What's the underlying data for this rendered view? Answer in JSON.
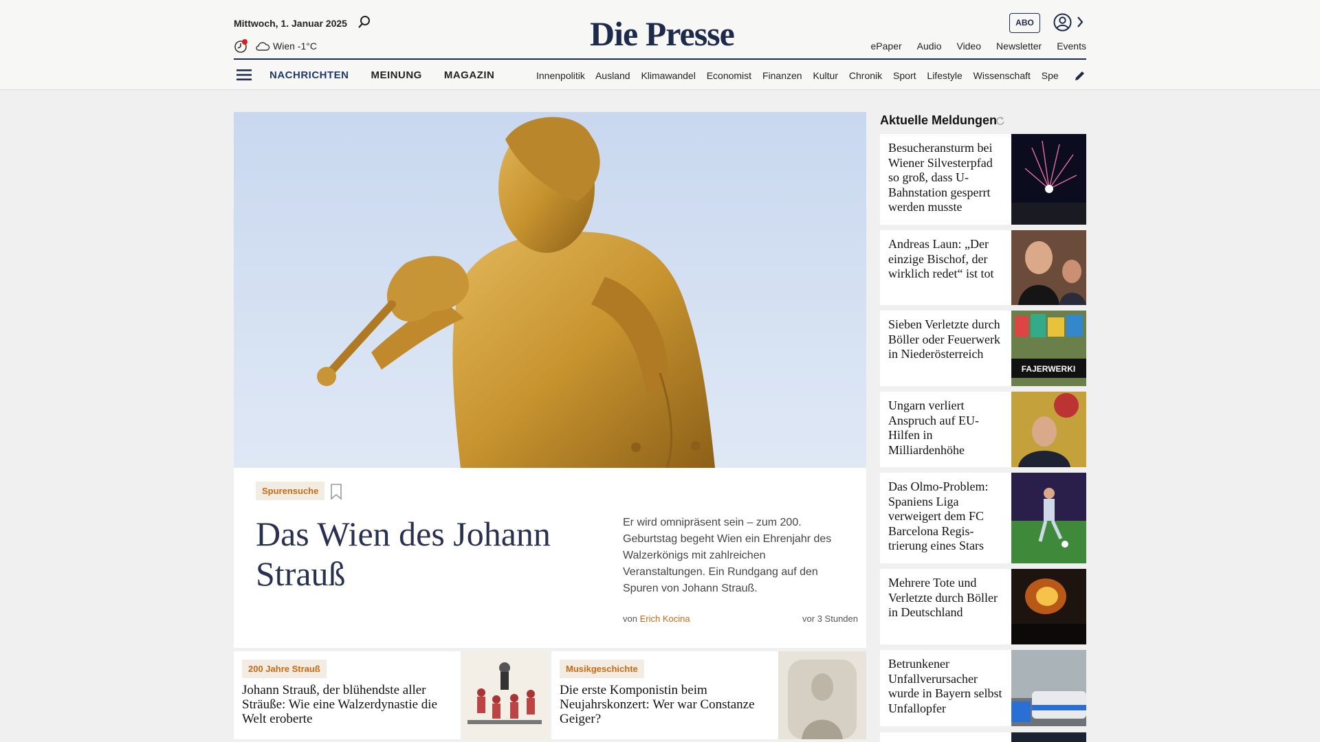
{
  "header": {
    "date": "Mittwoch, 1. Januar 2025",
    "weather": "Wien -1°C",
    "logo": "Die Presse",
    "abo": "ABO",
    "top_links": [
      "ePaper",
      "Audio",
      "Video",
      "Newsletter",
      "Events"
    ],
    "main_nav": [
      "NACHRICHTEN",
      "MEINUNG",
      "MAGAZIN"
    ],
    "sub_nav": [
      "Innenpolitik",
      "Ausland",
      "Klimawandel",
      "Economist",
      "Finanzen",
      "Kultur",
      "Chronik",
      "Sport",
      "Lifestyle",
      "Wissenschaft",
      "Spectrum"
    ],
    "accent_color": "#1e2a4a"
  },
  "hero": {
    "tag": "Spurensuche",
    "title": "Das Wien des Johann Strauß",
    "lead": "Er wird omnipräsent sein – zum 200. Geburtstag begeht Wien ein Ehrenjahr des Walzerkönigs mit zahlreichen Veranstaltungen. Ein Rundgang auf den Spuren von Johann Strauß.",
    "byline_prefix": "von",
    "author": "Erich Kocina",
    "time": "vor 3 Stunden"
  },
  "cards": [
    {
      "tag": "200 Jahre Strauß",
      "title": "Johann Strauß, der blühendste aller Sträuße: Wie eine Walzerdynastie die Welt eroberte"
    },
    {
      "tag": "Musikgeschichte",
      "title": "Die erste Komponistin beim Neujahrskonzert: Wer war Constanze Geiger?"
    }
  ],
  "sidebar": {
    "heading": "Aktuelle Meldungen",
    "items": [
      {
        "title": "Besucheransturm bei Wiener Silvesterpfad so groß, dass U-Bahnstation gesperrt werden musste"
      },
      {
        "title": "Andreas Laun: „Der einzige Bischof, der wirklich redet“ ist tot"
      },
      {
        "title": "Sieben Verletzte durch Böller oder Feuerwerk in Niederösterreich",
        "image_text": "FAJERWERKI"
      },
      {
        "title": "Ungarn verliert Anspruch auf EU-Hilfen in Milliardenhöhe"
      },
      {
        "title": "Das Olmo-Problem: Spaniens Liga verweigert dem FC Barcelona Regis­trierung eines Stars"
      },
      {
        "title": "Mehrere Tote und Verletzte durch Böller in Deutschland"
      },
      {
        "title": "Betrunkener Unfallverursacher wurde in Bayern selbst Unfallopfer"
      }
    ]
  }
}
